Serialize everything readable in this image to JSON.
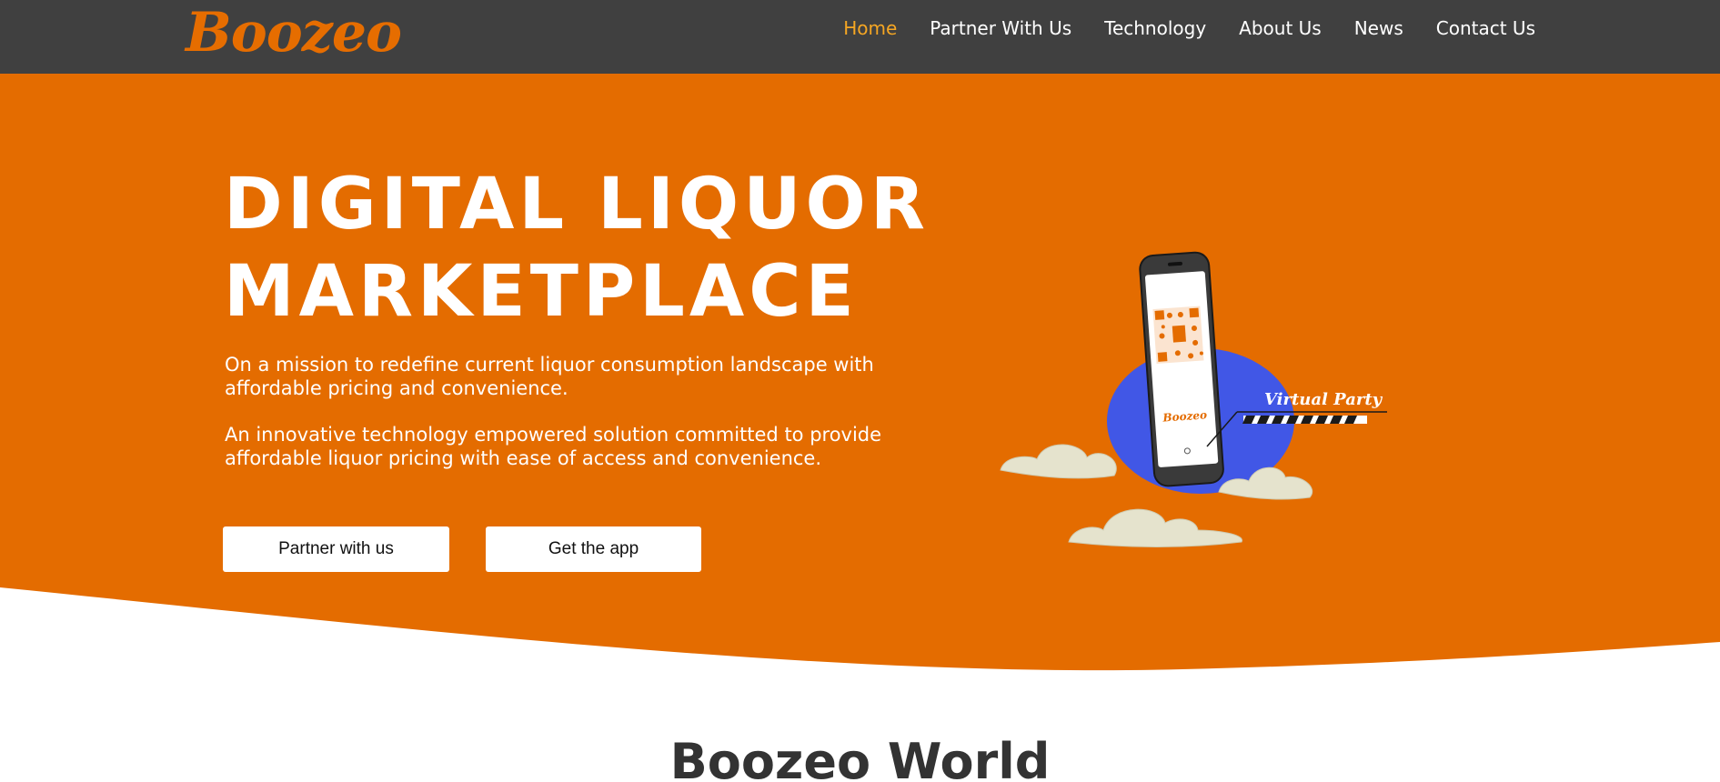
{
  "brand": {
    "logo_text": "Boozeo",
    "accent": "#e46c00",
    "nav_bg": "#404040",
    "active_color": "#f5a623"
  },
  "nav": {
    "items": [
      {
        "label": "Home",
        "active": true
      },
      {
        "label": "Partner With Us",
        "active": false
      },
      {
        "label": "Technology",
        "active": false
      },
      {
        "label": "About Us",
        "active": false
      },
      {
        "label": "News",
        "active": false
      },
      {
        "label": "Contact Us",
        "active": false
      }
    ]
  },
  "hero": {
    "title_line1": "DIGITAL LIQUOR",
    "title_line2": "MARKETPLACE",
    "paragraph1": "On a mission to redefine current liquor consumption landscape with affordable pricing and convenience.",
    "paragraph2": "An innovative technology empowered solution committed to provide affordable liquor pricing with ease of access and convenience.",
    "buttons": {
      "partner": "Partner with us",
      "app": "Get the app"
    },
    "illustration": {
      "tag_text": "Virtual Party",
      "phone_brand": "Boozeo",
      "icon": "phone-qr-illustration"
    }
  },
  "section": {
    "heading": "Boozeo World"
  }
}
